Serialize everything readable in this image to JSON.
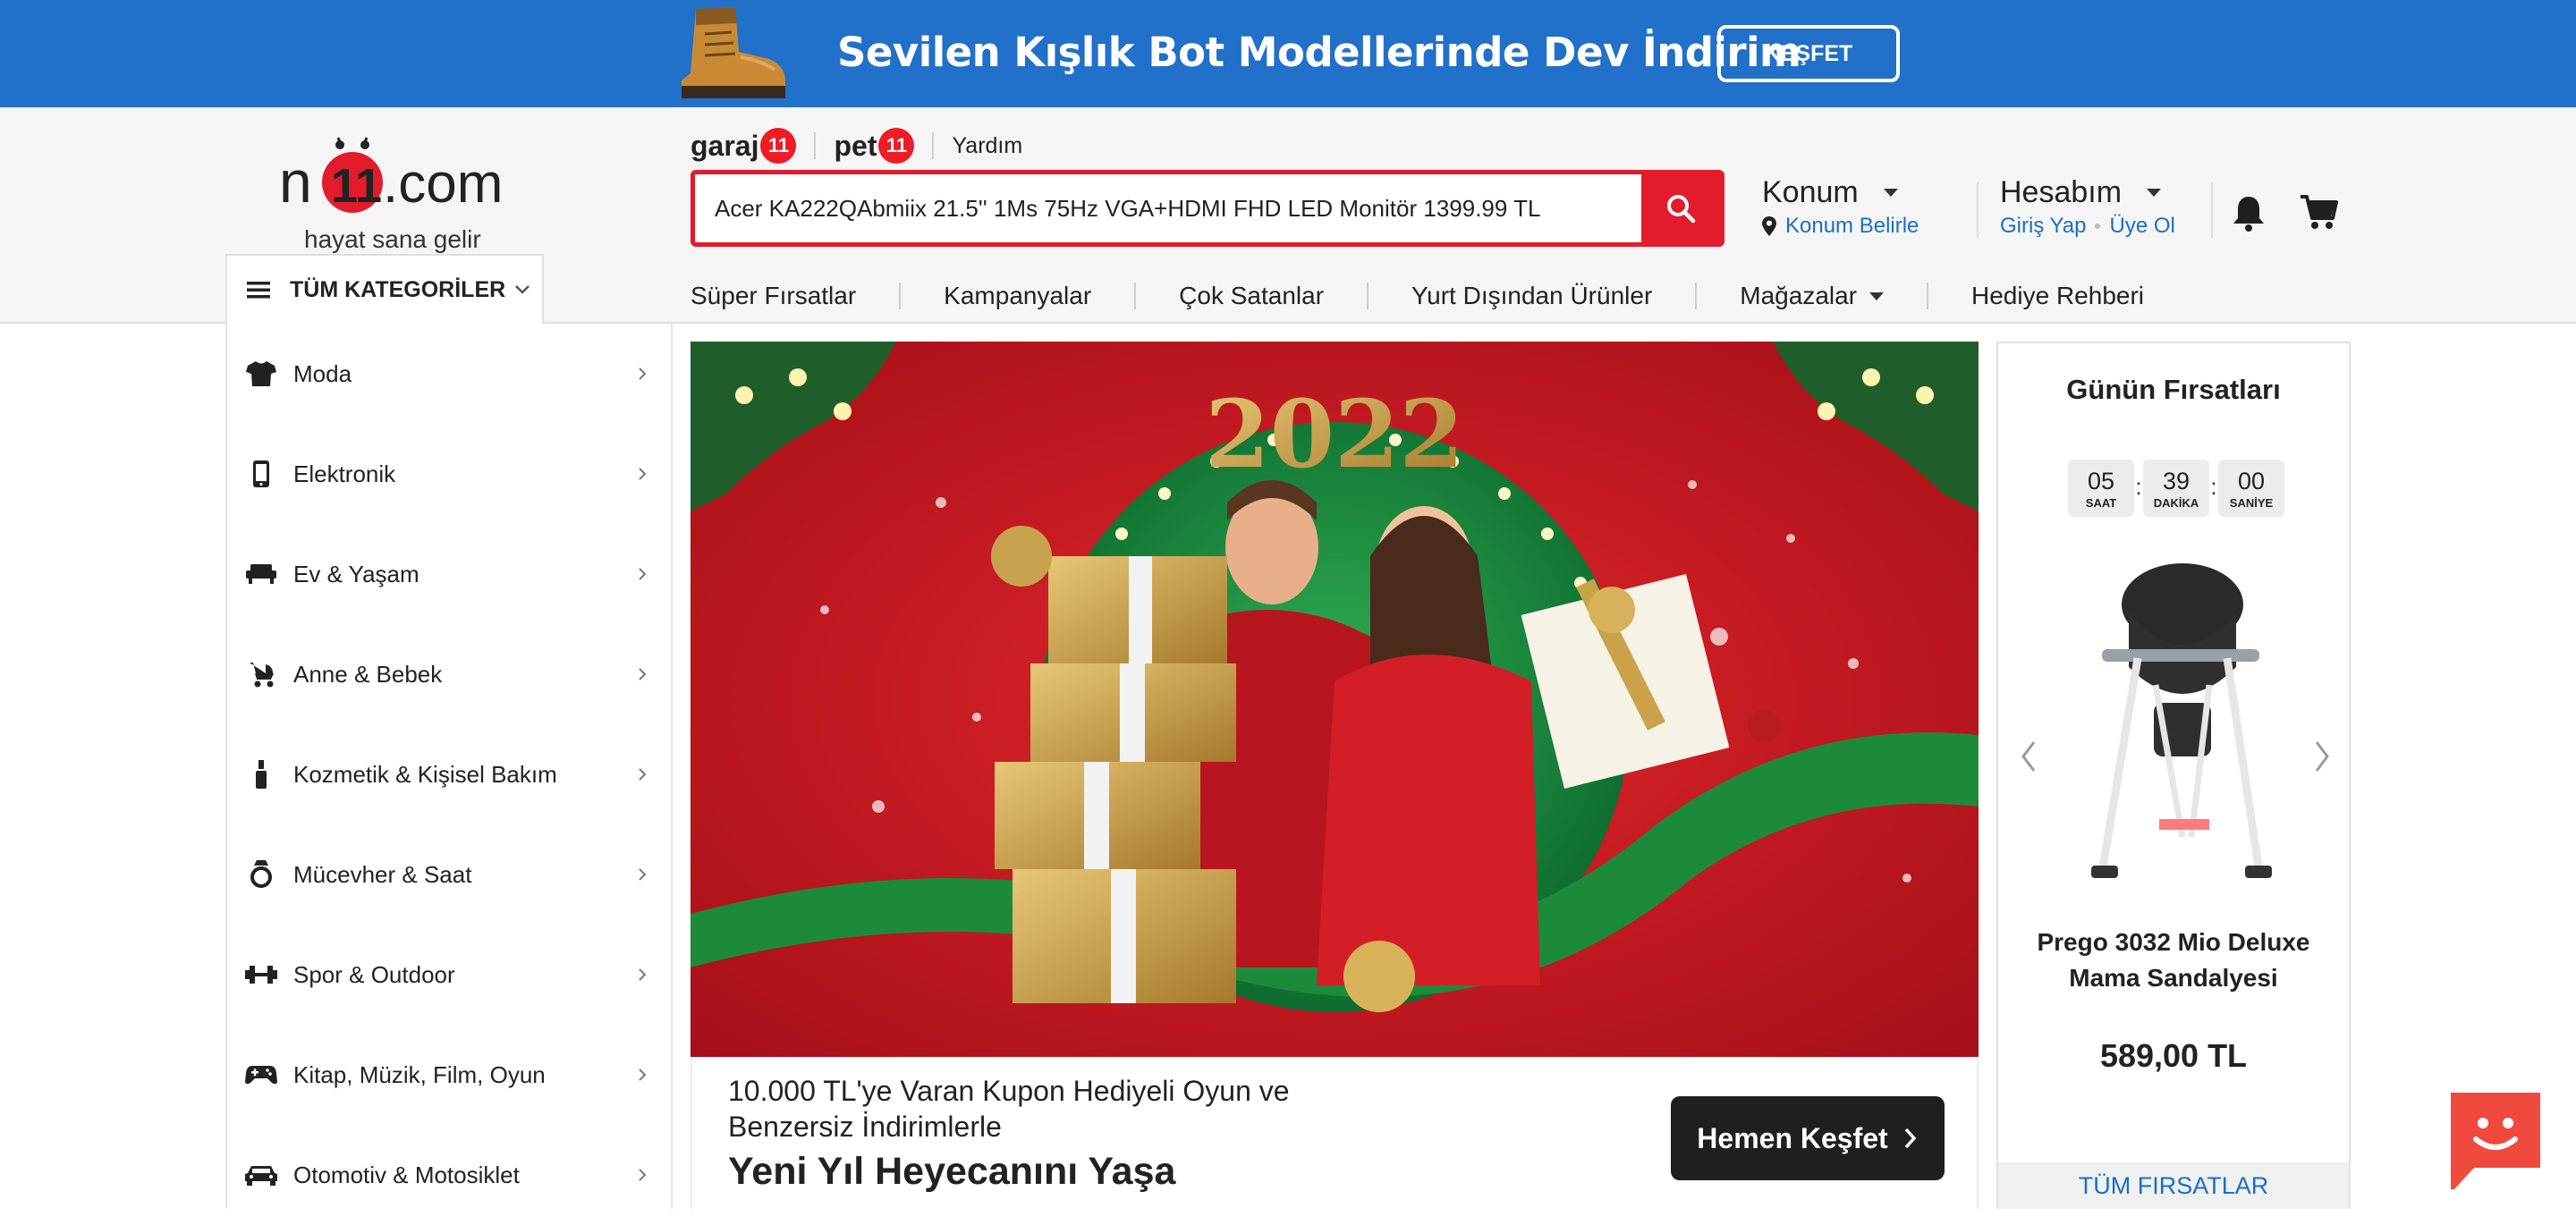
{
  "promo": {
    "text": "Sevilen Kışlık Bot Modellerinde Dev İndirim",
    "button": "KEŞFET"
  },
  "logo": {
    "wordmark_prefix": "n",
    "wordmark_badge": "11",
    "wordmark_suffix": ".com",
    "tagline": "hayat sana gelir"
  },
  "sublinks": {
    "garaj": "garaj",
    "pet": "pet",
    "badge": "11",
    "help": "Yardım"
  },
  "search": {
    "value": "Acer KA222QAbmiix 21.5'' 1Ms 75Hz VGA+HDMI FHD LED Monitör 1399.99 TL"
  },
  "location": {
    "title": "Konum",
    "link": "Konum Belirle"
  },
  "account": {
    "title": "Hesabım",
    "login": "Giriş Yap",
    "signup": "Üye Ol"
  },
  "categories_button": "TÜM KATEGORİLER",
  "nav": [
    "Süper Fırsatlar",
    "Kampanyalar",
    "Çok Satanlar",
    "Yurt Dışından Ürünler",
    "Mağazalar",
    "Hediye Rehberi"
  ],
  "categories": [
    {
      "label": "Moda",
      "icon": "tshirt-icon"
    },
    {
      "label": "Elektronik",
      "icon": "phone-icon"
    },
    {
      "label": "Ev & Yaşam",
      "icon": "sofa-icon"
    },
    {
      "label": "Anne & Bebek",
      "icon": "stroller-icon"
    },
    {
      "label": "Kozmetik & Kişisel Bakım",
      "icon": "cosmetic-bottle-icon"
    },
    {
      "label": "Mücevher & Saat",
      "icon": "ring-icon"
    },
    {
      "label": "Spor & Outdoor",
      "icon": "dumbbell-icon"
    },
    {
      "label": "Kitap, Müzik, Film, Oyun",
      "icon": "gamepad-icon"
    },
    {
      "label": "Otomotiv & Motosiklet",
      "icon": "car-icon"
    }
  ],
  "hero": {
    "year": "2022",
    "subtitle": "10.000 TL'ye Varan Kupon Hediyeli Oyun ve Benzersiz İndirimlerle",
    "title": "Yeni Yıl Heyecanını Yaşa",
    "cta": "Hemen Keşfet"
  },
  "deal": {
    "title": "Günün Fırsatları",
    "timer": [
      {
        "value": "05",
        "unit": "SAAT"
      },
      {
        "value": "39",
        "unit": "DAKİKA"
      },
      {
        "value": "00",
        "unit": "SANİYE"
      }
    ],
    "product_name": "Prego 3032 Mio Deluxe Mama Sandalyesi",
    "price": "589,00 TL",
    "all_button": "TÜM FIRSATLAR"
  },
  "colors": {
    "promo_bg": "#2170c9",
    "brand_red": "#e21c2c",
    "link_blue": "#1a6fc4",
    "chat": "#f04a3e"
  }
}
